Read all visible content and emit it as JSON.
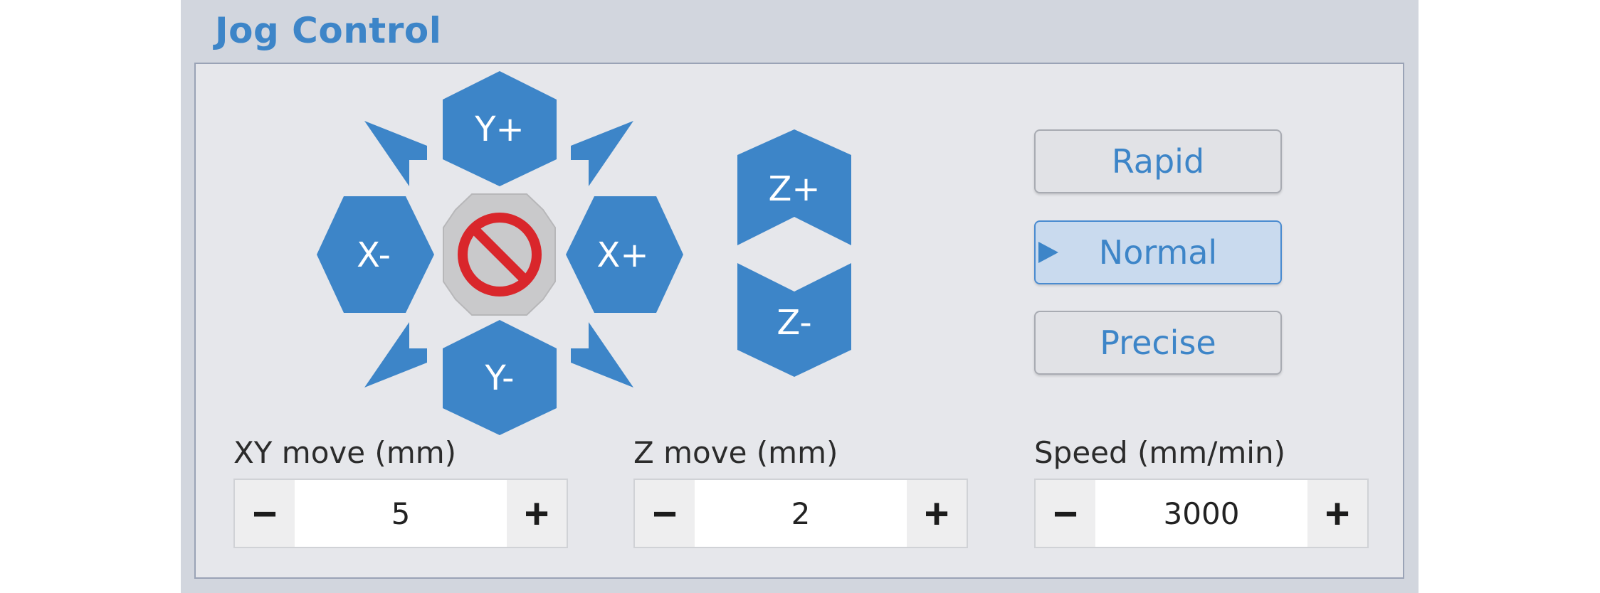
{
  "panel": {
    "title": "Jog Control"
  },
  "jog": {
    "y_plus": "Y+",
    "y_minus": "Y-",
    "x_plus": "X+",
    "x_minus": "X-",
    "z_plus": "Z+",
    "z_minus": "Z-",
    "center_icon": "stop-icon"
  },
  "modes": {
    "rapid": "Rapid",
    "normal": "Normal",
    "precise": "Precise",
    "selected": "Normal"
  },
  "fields": {
    "xy": {
      "label": "XY move (mm)",
      "value": "5"
    },
    "z": {
      "label": "Z move (mm)",
      "value": "2"
    },
    "speed": {
      "label": "Speed (mm/min)",
      "value": "3000"
    }
  },
  "stepper": {
    "minus": "−",
    "plus": "+"
  },
  "colors": {
    "accent": "#3d85c8",
    "stop_red": "#d9262b",
    "panel_bg": "#d2d6de"
  }
}
